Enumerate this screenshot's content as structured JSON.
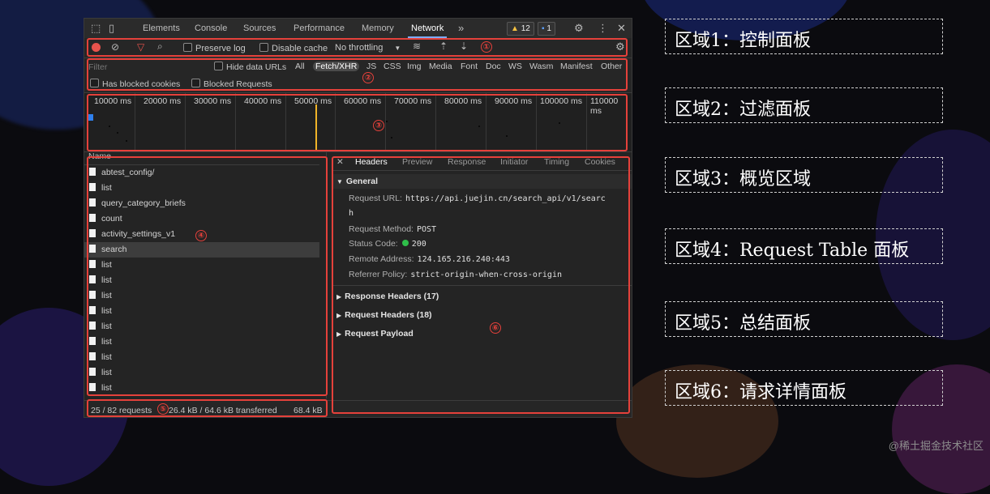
{
  "devtools": {
    "tabs": [
      "Elements",
      "Console",
      "Sources",
      "Performance",
      "Memory",
      "Network"
    ],
    "active_tab": "Network",
    "more_tabs_glyph": "»",
    "warnings_count": "12",
    "messages_count": "1",
    "toolbar": {
      "preserve_log": "Preserve log",
      "disable_cache": "Disable cache",
      "throttling": "No throttling"
    },
    "filter": {
      "placeholder": "Filter",
      "hide_data_urls": "Hide data URLs",
      "types": [
        "All",
        "Fetch/XHR",
        "JS",
        "CSS",
        "Img",
        "Media",
        "Font",
        "Doc",
        "WS",
        "Wasm",
        "Manifest",
        "Other"
      ],
      "active_type": "Fetch/XHR",
      "has_blocked_cookies": "Has blocked cookies",
      "blocked_requests": "Blocked Requests"
    },
    "overview_ticks": [
      "10000 ms",
      "20000 ms",
      "30000 ms",
      "40000 ms",
      "50000 ms",
      "60000 ms",
      "70000 ms",
      "80000 ms",
      "90000 ms",
      "100000 ms",
      "110000 ms"
    ],
    "request_table": {
      "header": "Name",
      "rows": [
        "abtest_config/",
        "list",
        "query_category_briefs",
        "count",
        "activity_settings_v1",
        "search",
        "list",
        "list",
        "list",
        "list",
        "list",
        "list",
        "list",
        "list",
        "list"
      ],
      "selected": "search"
    },
    "detail": {
      "tabs": [
        "Headers",
        "Preview",
        "Response",
        "Initiator",
        "Timing",
        "Cookies"
      ],
      "active_tab": "Headers",
      "general_title": "General",
      "request_url_label": "Request URL:",
      "request_url_value": "https://api.juejin.cn/search_api/v1/searc",
      "request_url_wrap": "h",
      "request_method_label": "Request Method:",
      "request_method_value": "POST",
      "status_code_label": "Status Code:",
      "status_code_value": "200",
      "remote_address_label": "Remote Address:",
      "remote_address_value": "124.165.216.240:443",
      "referrer_policy_label": "Referrer Policy:",
      "referrer_policy_value": "strict-origin-when-cross-origin",
      "response_headers": "Response Headers (17)",
      "request_headers": "Request Headers (18)",
      "request_payload": "Request Payload"
    },
    "status": {
      "requests": "25 / 82 requests",
      "transferred": "26.4 kB / 64.6 kB transferred",
      "resources": "68.4 kB"
    }
  },
  "region_markers": [
    "①",
    "②",
    "③",
    "④",
    "⑤",
    "⑥"
  ],
  "legend": [
    "区域1：控制面板",
    "区域2：过滤面板",
    "区域3：概览区域",
    "区域4：Request Table 面板",
    "区域5：总结面板",
    "区域6：请求详情面板"
  ],
  "watermark": "@稀土掘金技术社区",
  "colors": {
    "highlight_red": "#e5413b",
    "active_tab_underline": "#7cacf8",
    "status_ok": "#2fbf4a",
    "record_red": "#e8534c"
  }
}
